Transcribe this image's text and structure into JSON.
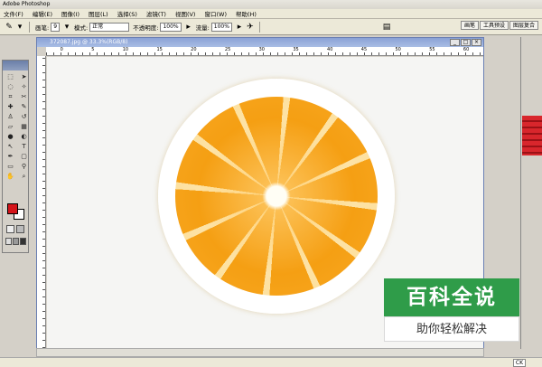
{
  "app": {
    "title": "Adobe Photoshop"
  },
  "menu": {
    "items": [
      "文件(F)",
      "编辑(E)",
      "图像(I)",
      "图层(L)",
      "选择(S)",
      "滤镜(T)",
      "视图(V)",
      "窗口(W)",
      "帮助(H)"
    ]
  },
  "options": {
    "brush_label": "画笔:",
    "brush_size": "9",
    "mode_label": "模式:",
    "mode_value": "正常",
    "opacity_label": "不透明度:",
    "opacity_value": "100%",
    "flow_label": "流量:",
    "flow_value": "100%"
  },
  "panel_wells": [
    "画笔",
    "工具预设",
    "图层复合"
  ],
  "document": {
    "title": "372087.jpg @ 33.3%(RGB/8)"
  },
  "ruler": {
    "h_numbers": [
      "0",
      "5",
      "10",
      "15",
      "20",
      "25",
      "30",
      "35",
      "40",
      "45",
      "50",
      "55",
      "60"
    ]
  },
  "status": {
    "tag": "CK"
  },
  "watermark": {
    "line1": "百科全说",
    "line2": "助你轻松解决"
  },
  "colors": {
    "foreground": "#d4141a",
    "background": "#ffffff",
    "accent": "#2f9c49"
  }
}
